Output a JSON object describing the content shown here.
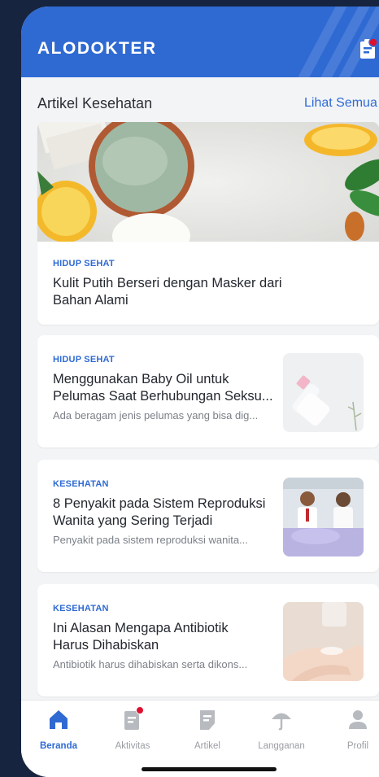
{
  "app": {
    "brand": "ALODOKTER"
  },
  "section": {
    "title": "Artikel Kesehatan",
    "see_all": "Lihat Semua"
  },
  "featured": {
    "category": "HIDUP SEHAT",
    "title": "Kulit Putih Berseri dengan Masker dari Bahan Alami"
  },
  "articles": [
    {
      "category": "HIDUP SEHAT",
      "title_line1": "Menggunakan Baby Oil untuk",
      "title_line2": "Pelumas Saat Berhubungan Seksu...",
      "excerpt": "Ada beragam jenis pelumas yang bisa dig..."
    },
    {
      "category": "KESEHATAN",
      "title_line1": "8 Penyakit pada Sistem Reproduksi",
      "title_line2": "Wanita yang Sering Terjadi",
      "excerpt": "Penyakit pada sistem reproduksi wanita..."
    },
    {
      "category": "KESEHATAN",
      "title_line1": "Ini Alasan Mengapa Antibiotik",
      "title_line2": "Harus Dihabiskan",
      "excerpt": "Antibiotik harus dihabiskan serta dikons..."
    }
  ],
  "nav": [
    {
      "label": "Beranda",
      "icon": "home-icon",
      "active": true
    },
    {
      "label": "Aktivitas",
      "icon": "activity-icon",
      "badge": true
    },
    {
      "label": "Artikel",
      "icon": "article-icon"
    },
    {
      "label": "Langganan",
      "icon": "umbrella-icon"
    },
    {
      "label": "Profil",
      "icon": "person-icon"
    }
  ],
  "colors": {
    "primary": "#2f6ad3",
    "badge": "#e0102e",
    "inactive": "#9a9da3"
  }
}
